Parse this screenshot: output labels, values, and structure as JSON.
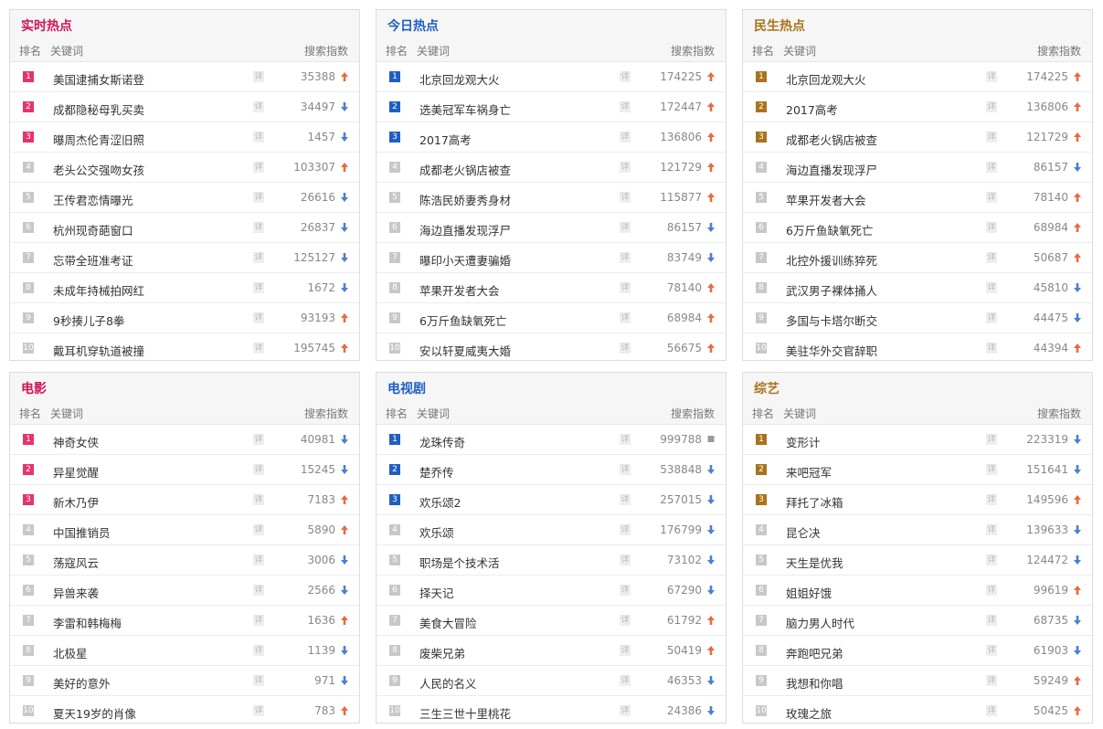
{
  "colors": {
    "rank_top_red": "#e8336a",
    "rank_top_blue": "#1f5fc2",
    "rank_top_brown": "#a8741a",
    "rank_other": "#c8c8c8",
    "up": "#ea6a3d",
    "down": "#4a7fd0",
    "flat": "#9a9a9a"
  },
  "headers": {
    "rank": "排名",
    "keyword": "关键词",
    "index": "搜索指数",
    "detail": "详"
  },
  "panels": [
    {
      "id": "realtime",
      "title": "实时热点",
      "title_color": "#d0155a",
      "rank_color": "#e8336a",
      "rows": [
        {
          "rank": "1",
          "kw": "美国逮捕女斯诺登",
          "val": "35388",
          "trend": "up"
        },
        {
          "rank": "2",
          "kw": "成都隐秘母乳买卖",
          "val": "34497",
          "trend": "down"
        },
        {
          "rank": "3",
          "kw": "曝周杰伦青涩旧照",
          "val": "1457",
          "trend": "down"
        },
        {
          "rank": "4",
          "kw": "老头公交强吻女孩",
          "val": "103307",
          "trend": "up"
        },
        {
          "rank": "5",
          "kw": "王传君恋情曝光",
          "val": "26616",
          "trend": "down"
        },
        {
          "rank": "6",
          "kw": "杭州现奇葩窗口",
          "val": "26837",
          "trend": "down"
        },
        {
          "rank": "7",
          "kw": "忘带全班准考证",
          "val": "125127",
          "trend": "down"
        },
        {
          "rank": "8",
          "kw": "未成年持械拍网红",
          "val": "1672",
          "trend": "down"
        },
        {
          "rank": "9",
          "kw": "9秒揍儿子8拳",
          "val": "93193",
          "trend": "up"
        },
        {
          "rank": "10",
          "kw": "戴耳机穿轨道被撞",
          "val": "195745",
          "trend": "up"
        }
      ]
    },
    {
      "id": "today",
      "title": "今日热点",
      "title_color": "#1f5fc2",
      "rank_color": "#1f5fc2",
      "rows": [
        {
          "rank": "1",
          "kw": "北京回龙观大火",
          "val": "174225",
          "trend": "up"
        },
        {
          "rank": "2",
          "kw": "选美冠军车祸身亡",
          "val": "172447",
          "trend": "up"
        },
        {
          "rank": "3",
          "kw": "2017高考",
          "val": "136806",
          "trend": "up"
        },
        {
          "rank": "4",
          "kw": "成都老火锅店被查",
          "val": "121729",
          "trend": "up"
        },
        {
          "rank": "5",
          "kw": "陈浩民娇妻秀身材",
          "val": "115877",
          "trend": "up"
        },
        {
          "rank": "6",
          "kw": "海边直播发现浮尸",
          "val": "86157",
          "trend": "down"
        },
        {
          "rank": "7",
          "kw": "曝印小天遭妻骗婚",
          "val": "83749",
          "trend": "down"
        },
        {
          "rank": "8",
          "kw": "苹果开发者大会",
          "val": "78140",
          "trend": "up"
        },
        {
          "rank": "9",
          "kw": "6万斤鱼缺氧死亡",
          "val": "68984",
          "trend": "up"
        },
        {
          "rank": "10",
          "kw": "安以轩夏威夷大婚",
          "val": "56675",
          "trend": "up"
        }
      ]
    },
    {
      "id": "livelihood",
      "title": "民生热点",
      "title_color": "#a8741a",
      "rank_color": "#a8741a",
      "rows": [
        {
          "rank": "1",
          "kw": "北京回龙观大火",
          "val": "174225",
          "trend": "up"
        },
        {
          "rank": "2",
          "kw": "2017高考",
          "val": "136806",
          "trend": "up"
        },
        {
          "rank": "3",
          "kw": "成都老火锅店被查",
          "val": "121729",
          "trend": "up"
        },
        {
          "rank": "4",
          "kw": "海边直播发现浮尸",
          "val": "86157",
          "trend": "down"
        },
        {
          "rank": "5",
          "kw": "苹果开发者大会",
          "val": "78140",
          "trend": "up"
        },
        {
          "rank": "6",
          "kw": "6万斤鱼缺氧死亡",
          "val": "68984",
          "trend": "up"
        },
        {
          "rank": "7",
          "kw": "北控外援训练猝死",
          "val": "50687",
          "trend": "up"
        },
        {
          "rank": "8",
          "kw": "武汉男子裸体捅人",
          "val": "45810",
          "trend": "down"
        },
        {
          "rank": "9",
          "kw": "多国与卡塔尔断交",
          "val": "44475",
          "trend": "down"
        },
        {
          "rank": "10",
          "kw": "美驻华外交官辞职",
          "val": "44394",
          "trend": "up"
        }
      ]
    },
    {
      "id": "movie",
      "title": "电影",
      "title_color": "#d0155a",
      "rank_color": "#e8336a",
      "rows": [
        {
          "rank": "1",
          "kw": "神奇女侠",
          "val": "40981",
          "trend": "down"
        },
        {
          "rank": "2",
          "kw": "异星觉醒",
          "val": "15245",
          "trend": "down"
        },
        {
          "rank": "3",
          "kw": "新木乃伊",
          "val": "7183",
          "trend": "up"
        },
        {
          "rank": "4",
          "kw": "中国推销员",
          "val": "5890",
          "trend": "up"
        },
        {
          "rank": "5",
          "kw": "荡寇风云",
          "val": "3006",
          "trend": "down"
        },
        {
          "rank": "6",
          "kw": "异兽来袭",
          "val": "2566",
          "trend": "down"
        },
        {
          "rank": "7",
          "kw": "李雷和韩梅梅",
          "val": "1636",
          "trend": "up"
        },
        {
          "rank": "8",
          "kw": "北极星",
          "val": "1139",
          "trend": "down"
        },
        {
          "rank": "9",
          "kw": "美好的意外",
          "val": "971",
          "trend": "down"
        },
        {
          "rank": "10",
          "kw": "夏天19岁的肖像",
          "val": "783",
          "trend": "up"
        }
      ]
    },
    {
      "id": "tv",
      "title": "电视剧",
      "title_color": "#1f5fc2",
      "rank_color": "#1f5fc2",
      "rows": [
        {
          "rank": "1",
          "kw": "龙珠传奇",
          "val": "999788",
          "trend": "flat"
        },
        {
          "rank": "2",
          "kw": "楚乔传",
          "val": "538848",
          "trend": "down"
        },
        {
          "rank": "3",
          "kw": "欢乐颂2",
          "val": "257015",
          "trend": "down"
        },
        {
          "rank": "4",
          "kw": "欢乐颂",
          "val": "176799",
          "trend": "down"
        },
        {
          "rank": "5",
          "kw": "职场是个技术活",
          "val": "73102",
          "trend": "down"
        },
        {
          "rank": "6",
          "kw": "择天记",
          "val": "67290",
          "trend": "down"
        },
        {
          "rank": "7",
          "kw": "美食大冒险",
          "val": "61792",
          "trend": "up"
        },
        {
          "rank": "8",
          "kw": "废柴兄弟",
          "val": "50419",
          "trend": "up"
        },
        {
          "rank": "9",
          "kw": "人民的名义",
          "val": "46353",
          "trend": "down"
        },
        {
          "rank": "10",
          "kw": "三生三世十里桃花",
          "val": "24386",
          "trend": "down"
        }
      ]
    },
    {
      "id": "variety",
      "title": "综艺",
      "title_color": "#a8741a",
      "rank_color": "#a8741a",
      "rows": [
        {
          "rank": "1",
          "kw": "变形计",
          "val": "223319",
          "trend": "down"
        },
        {
          "rank": "2",
          "kw": "来吧冠军",
          "val": "151641",
          "trend": "down"
        },
        {
          "rank": "3",
          "kw": "拜托了冰箱",
          "val": "149596",
          "trend": "up"
        },
        {
          "rank": "4",
          "kw": "昆仑决",
          "val": "139633",
          "trend": "down"
        },
        {
          "rank": "5",
          "kw": "天生是优我",
          "val": "124472",
          "trend": "down"
        },
        {
          "rank": "6",
          "kw": "姐姐好饿",
          "val": "99619",
          "trend": "up"
        },
        {
          "rank": "7",
          "kw": "脑力男人时代",
          "val": "68735",
          "trend": "down"
        },
        {
          "rank": "8",
          "kw": "奔跑吧兄弟",
          "val": "61903",
          "trend": "down"
        },
        {
          "rank": "9",
          "kw": "我想和你唱",
          "val": "59249",
          "trend": "up"
        },
        {
          "rank": "10",
          "kw": "玫瑰之旅",
          "val": "50425",
          "trend": "up"
        }
      ]
    }
  ]
}
